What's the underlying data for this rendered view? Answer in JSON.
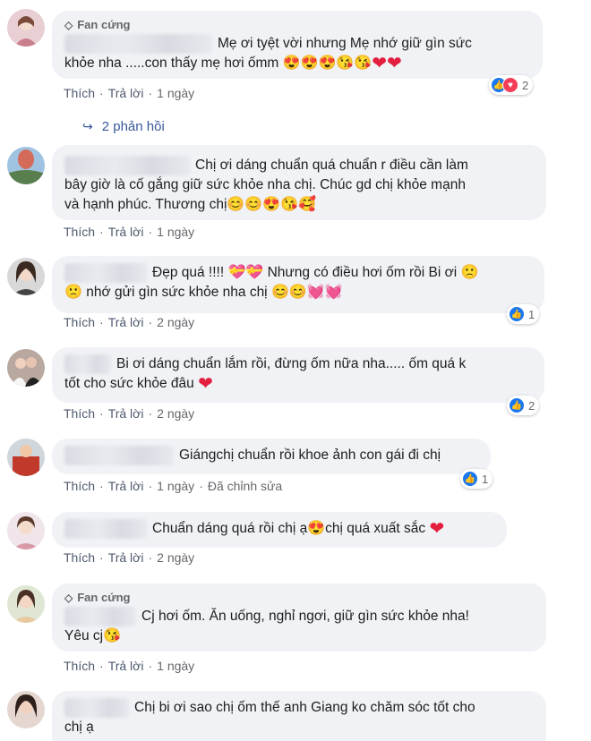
{
  "badge_label": "Fan cứng",
  "actions": {
    "like": "Thích",
    "reply": "Trả lời",
    "separator": "·"
  },
  "replies_link": "2 phản hồi",
  "comments": [
    {
      "id": 1,
      "badge": true,
      "text_line1": "Mẹ ơi tyệt vời nhưng Mẹ nhớ giữ gìn sức",
      "text_line2": "khỏe nha .....con thấy mẹ hơi ốmm",
      "emojis": [
        "😍",
        "😍",
        "😍",
        "😘",
        "😘",
        "❤",
        "❤"
      ],
      "time": "1 ngày",
      "reaction_count": "2",
      "reactions": [
        "like",
        "love"
      ]
    },
    {
      "id": 2,
      "badge": false,
      "text_line1": "Chị ơi dáng chuẩn quá chuẩn r điều cần làm",
      "text_line2": "bây giờ là cố gắng giữ sức khỏe nha chị. Chúc gd chị khỏe mạnh",
      "text_line3": "và hạnh phúc. Thương chị",
      "emojis": [
        "😊",
        "😊",
        "😍",
        "😘",
        "🥰"
      ],
      "time": "1 ngày"
    },
    {
      "id": 3,
      "badge": false,
      "text_line1": "Đẹp quá !!!!",
      "text_line1b": "Nhưng có điều hơi ốm rồi Bi ơi",
      "text_line2": "nhớ gửi gìn sức khỏe nha chị",
      "emojis_a": [
        "💝",
        "💝"
      ],
      "emojis_b": [
        "🙁"
      ],
      "emojis_c": [
        "🙁"
      ],
      "emojis_d": [
        "😊",
        "😊",
        "💓",
        "💓"
      ],
      "time": "2 ngày",
      "reaction_count": "1",
      "reactions": [
        "like"
      ]
    },
    {
      "id": 4,
      "badge": false,
      "text_line1": "Bi ơi dáng chuẩn lắm rồi, đừng ốm nữa nha..... ốm quá k",
      "text_line2": "tốt cho sức khỏe đâu",
      "emojis": [
        "❤"
      ],
      "time": "2 ngày",
      "reaction_count": "2",
      "reactions": [
        "like"
      ]
    },
    {
      "id": 5,
      "badge": false,
      "text_line1": "Giángchị chuẩn rồi khoe ảnh con gái đi chị",
      "time": "1 ngày",
      "edited": "Đã chỉnh sửa",
      "reaction_count": "1",
      "reactions": [
        "like"
      ]
    },
    {
      "id": 6,
      "badge": false,
      "text_line1a": "Chuẩn dáng quá rồi chị ạ",
      "text_line1b": "chị quá xuất sắc",
      "emojis_a": [
        "😍"
      ],
      "emojis_b": [
        "❤"
      ],
      "time": "2 ngày"
    },
    {
      "id": 7,
      "badge": true,
      "text_line1": "Cj hơi ốm. Ăn uống, nghỉ ngơi, giữ gìn sức khỏe nha!",
      "text_line2": "Yêu cj",
      "emojis": [
        "😘"
      ],
      "time": "1 ngày"
    },
    {
      "id": 8,
      "badge": false,
      "text_line1": "Chị bi ơi sao chị ốm thế anh Giang ko chăm sóc tốt cho",
      "text_line2": "chị ạ"
    }
  ],
  "colors": {
    "bubble": "#f0f2f5",
    "link": "#385898",
    "like": "#1877f2",
    "love": "#f33e58",
    "heart": "#e41e3f"
  }
}
